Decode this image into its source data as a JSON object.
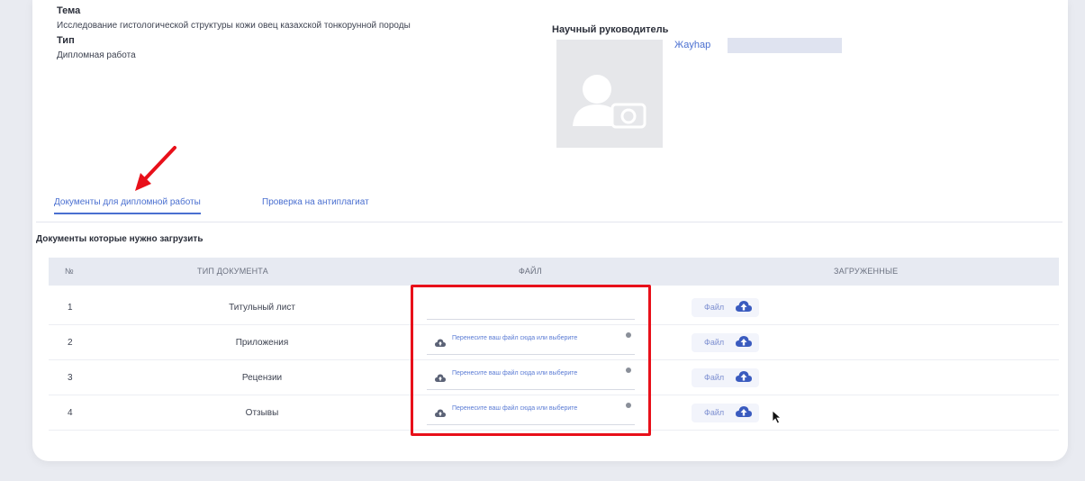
{
  "topic": {
    "label": "Тема",
    "value": "Исследование гистологической структуры кожи овец казахской тонкорунной породы"
  },
  "type": {
    "label": "Тип",
    "value": "Дипломная работа"
  },
  "supervisor": {
    "label": "Научный руководитель",
    "name": "Жаyhар"
  },
  "tabs": [
    {
      "label": "Документы для дипломной работы",
      "active": true
    },
    {
      "label": "Проверка на антиплагиат",
      "active": false
    }
  ],
  "section_title": "Документы которые нужно загрузить",
  "table": {
    "headers": [
      "№",
      "ТИП ДОКУМЕНТА",
      "ФАЙЛ",
      "ЗАГРУЖЕННЫЕ"
    ],
    "rows": [
      {
        "num": "1",
        "type": "Титульный лист",
        "has_upload": false
      },
      {
        "num": "2",
        "type": "Приложения",
        "has_upload": true
      },
      {
        "num": "3",
        "type": "Рецензии",
        "has_upload": true
      },
      {
        "num": "4",
        "type": "Отзывы",
        "has_upload": true
      }
    ],
    "upload_text": "Перенесите ваш файл сюда или выберите",
    "file_button_label": "Файл"
  },
  "colors": {
    "accent": "#4a6fd0",
    "highlight_red": "#e8101a",
    "header_bg": "#e7eaf2"
  }
}
